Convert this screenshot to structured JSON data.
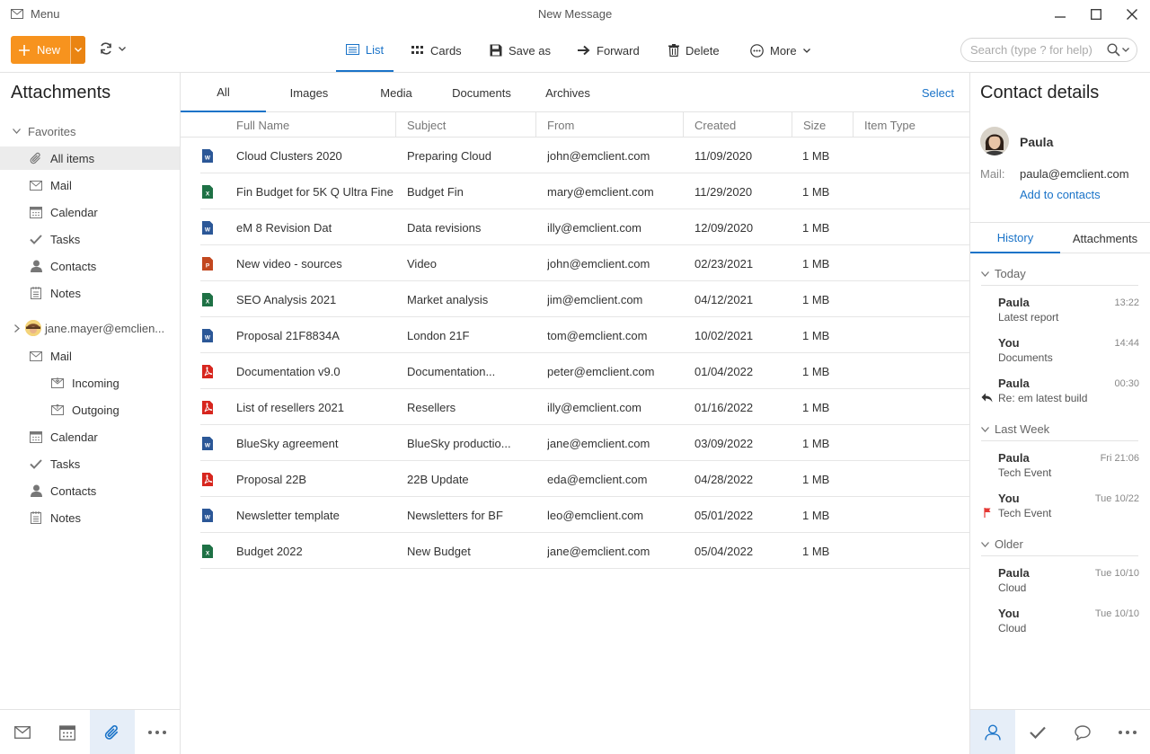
{
  "window": {
    "menu_label": "Menu",
    "title": "New Message"
  },
  "toolbar": {
    "new_label": "New",
    "search_placeholder": "Search (type ? for help)",
    "items": [
      {
        "label": "List",
        "icon": "list-icon",
        "active": true
      },
      {
        "label": "Cards",
        "icon": "cards-icon",
        "active": false
      },
      {
        "label": "Save as",
        "icon": "save-icon",
        "active": false
      },
      {
        "label": "Forward",
        "icon": "forward-arrow-icon",
        "active": false
      },
      {
        "label": "Delete",
        "icon": "trash-icon",
        "active": false
      },
      {
        "label": "More",
        "icon": "more-circle-icon",
        "active": false
      }
    ]
  },
  "sidebar": {
    "title": "Attachments",
    "favorites_label": "Favorites",
    "favorites": [
      {
        "label": "All items",
        "icon": "paperclip-icon",
        "selected": true
      },
      {
        "label": "Mail",
        "icon": "envelope-icon"
      },
      {
        "label": "Calendar",
        "icon": "calendar-icon"
      },
      {
        "label": "Tasks",
        "icon": "checkmark-icon"
      },
      {
        "label": "Contacts",
        "icon": "person-icon"
      },
      {
        "label": "Notes",
        "icon": "notes-icon"
      }
    ],
    "account_label": "jane.mayer@emclien...",
    "account_items": [
      {
        "label": "Mail",
        "icon": "envelope-icon",
        "indent": 0
      },
      {
        "label": "Incoming",
        "icon": "inbox-icon",
        "indent": 1
      },
      {
        "label": "Outgoing",
        "icon": "outbox-icon",
        "indent": 1
      },
      {
        "label": "Calendar",
        "icon": "calendar-icon",
        "indent": 0
      },
      {
        "label": "Tasks",
        "icon": "checkmark-icon",
        "indent": 0
      },
      {
        "label": "Contacts",
        "icon": "person-icon",
        "indent": 0
      },
      {
        "label": "Notes",
        "icon": "notes-icon",
        "indent": 0
      }
    ]
  },
  "main": {
    "filter_tabs": [
      "All",
      "Images",
      "Media",
      "Documents",
      "Archives"
    ],
    "active_filter": "All",
    "select_label": "Select",
    "columns": [
      "Full Name",
      "Subject",
      "From",
      "Created",
      "Size",
      "Item Type"
    ],
    "rows": [
      {
        "type": "word",
        "name": "Cloud Clusters 2020",
        "subject": "Preparing Cloud",
        "from": "john@emclient.com",
        "created": "11/09/2020",
        "size": "1 MB"
      },
      {
        "type": "excel",
        "name": "Fin Budget for 5K Q Ultra Fine",
        "subject": "Budget Fin",
        "from": "mary@emclient.com",
        "created": "11/29/2020",
        "size": "1 MB"
      },
      {
        "type": "word",
        "name": "eM 8 Revision Dat",
        "subject": "Data revisions",
        "from": "illy@emclient.com",
        "created": "12/09/2020",
        "size": "1 MB"
      },
      {
        "type": "powerpoint",
        "name": "New video - sources",
        "subject": "Video",
        "from": "john@emclient.com",
        "created": "02/23/2021",
        "size": "1 MB"
      },
      {
        "type": "excel",
        "name": "SEO Analysis 2021",
        "subject": "Market analysis",
        "from": "jim@emclient.com",
        "created": "04/12/2021",
        "size": "1 MB"
      },
      {
        "type": "word",
        "name": "Proposal 21F8834A",
        "subject": "London 21F",
        "from": "tom@emclient.com",
        "created": "10/02/2021",
        "size": "1 MB"
      },
      {
        "type": "pdf",
        "name": "Documentation v9.0",
        "subject": "Documentation...",
        "from": "peter@emclient.com",
        "created": "01/04/2022",
        "size": "1 MB"
      },
      {
        "type": "pdf",
        "name": "List of resellers 2021",
        "subject": "Resellers",
        "from": "illy@emclient.com",
        "created": "01/16/2022",
        "size": "1 MB"
      },
      {
        "type": "word",
        "name": "BlueSky agreement",
        "subject": "BlueSky productio...",
        "from": "jane@emclient.com",
        "created": "03/09/2022",
        "size": "1 MB"
      },
      {
        "type": "pdf",
        "name": "Proposal 22B",
        "subject": "22B Update",
        "from": "eda@emclient.com",
        "created": "04/28/2022",
        "size": "1 MB"
      },
      {
        "type": "word",
        "name": "Newsletter template",
        "subject": "Newsletters for BF",
        "from": "leo@emclient.com",
        "created": "05/01/2022",
        "size": "1 MB"
      },
      {
        "type": "excel",
        "name": "Budget 2022",
        "subject": "New Budget",
        "from": "jane@emclient.com",
        "created": "05/04/2022",
        "size": "1 MB"
      }
    ]
  },
  "contact": {
    "title": "Contact details",
    "name": "Paula",
    "mail_label": "Mail:",
    "mail": "paula@emclient.com",
    "add_label": "Add to contacts",
    "tabs": [
      "History",
      "Attachments"
    ],
    "active_tab": "History",
    "history": [
      {
        "group": "Today",
        "items": [
          {
            "who": "Paula",
            "subject": "Latest report",
            "time": "13:22",
            "mark": ""
          },
          {
            "who": "You",
            "subject": "Documents",
            "time": "14:44",
            "mark": ""
          },
          {
            "who": "Paula",
            "subject": "Re: em latest build",
            "time": "00:30",
            "mark": "reply"
          }
        ]
      },
      {
        "group": "Last Week",
        "items": [
          {
            "who": "Paula",
            "subject": "Tech Event",
            "time": "Fri 21:06",
            "mark": ""
          },
          {
            "who": "You",
            "subject": "Tech Event",
            "time": "Tue 10/22",
            "mark": "flag"
          }
        ]
      },
      {
        "group": "Older",
        "items": [
          {
            "who": "Paula",
            "subject": "Cloud",
            "time": "Tue 10/10",
            "mark": ""
          },
          {
            "who": "You",
            "subject": "Cloud",
            "time": "Tue 10/10",
            "mark": ""
          }
        ]
      }
    ]
  },
  "colors": {
    "accent": "#1a73c8",
    "new_button": "#f7931e",
    "word": "#2b5797",
    "excel": "#1e7145",
    "powerpoint": "#c2471f",
    "pdf": "#d7261e",
    "flag": "#e53935"
  }
}
